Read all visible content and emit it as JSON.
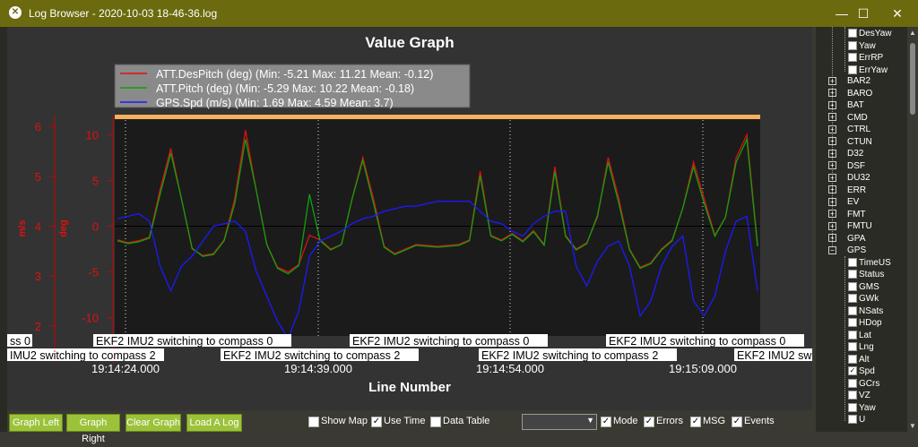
{
  "window": {
    "title": "Log Browser - 2020-10-03 18-46-36.log",
    "minimize": "—",
    "maximize": "☐",
    "close": "✕"
  },
  "graph": {
    "title": "Value Graph",
    "xlabel": "Line Number",
    "yaxis_left_label": "m/s",
    "yaxis_right_label": "deg",
    "ms_ticks": [
      "6",
      "5",
      "4",
      "3",
      "2"
    ],
    "deg_ticks": [
      "10",
      "5",
      "0",
      "-5",
      "-10"
    ],
    "time_labels": [
      "19:14:24.000",
      "19:14:39.000",
      "19:14:54.000",
      "19:15:09.000"
    ],
    "event_labels_row1": [
      "ss 0",
      "EKF2 IMU2 switching to compass 0",
      "EKF2 IMU2 switching to compass 0",
      "EKF2 IMU2 switching to compass 0"
    ],
    "event_labels_row2": [
      "IMU2 switching to compass 2",
      "EKF2 IMU2 switching to compass 2",
      "EKF2 IMU2 switching to compass 2",
      "EKF2 IMU2 sw"
    ],
    "colors": {
      "plot_bg": "#1b1b1b",
      "despitch": "#e01010",
      "pitch": "#10a010",
      "gps": "#1a1aff",
      "band": "#f5b060"
    }
  },
  "chart_data": {
    "type": "line",
    "x": [
      0,
      1,
      2,
      3,
      4,
      5,
      6,
      7,
      8,
      9,
      10,
      11,
      12,
      13,
      14,
      15,
      16,
      17,
      18,
      19,
      20,
      21,
      22,
      23,
      24,
      25,
      26,
      27,
      28,
      29,
      30,
      31,
      32,
      33,
      34,
      35,
      36,
      37,
      38,
      39,
      40,
      41,
      42,
      43,
      44,
      45,
      46,
      47,
      48,
      49,
      50,
      51,
      52,
      53,
      54,
      55,
      56,
      57,
      58,
      59,
      60
    ],
    "series": [
      {
        "name": "ATT.DesPitch (deg) (Min: -5.21 Max: 11.21 Mean: -0.12)",
        "axis": "deg",
        "values": [
          -1.5,
          -1.8,
          -1.6,
          -1.2,
          4,
          8.5,
          3,
          -2.5,
          -3.2,
          -3,
          -1.5,
          3,
          10.5,
          4,
          -2,
          -4.5,
          -5,
          -4.2,
          -1,
          -1.5,
          -2.5,
          -2,
          3,
          7.5,
          3,
          -2.2,
          -3,
          -2.5,
          -2,
          -2.1,
          -2.2,
          -2.1,
          -2,
          -1.5,
          6,
          -1,
          -1.5,
          -0.8,
          -1.6,
          -0.5,
          -2,
          6.5,
          -1,
          -2.5,
          -1.8,
          1,
          7.5,
          3,
          -2.5,
          -4.5,
          -4,
          -2.5,
          -1.5,
          2,
          7,
          3,
          -1,
          1,
          7.5,
          10,
          -2
        ]
      },
      {
        "name": "ATT.Pitch (deg) (Min: -5.29 Max: 10.22 Mean: -0.18)",
        "axis": "deg",
        "values": [
          -1.6,
          -1.9,
          -1.7,
          -1.3,
          3.5,
          8,
          3,
          -2.4,
          -3.3,
          -3.1,
          -1.6,
          2.5,
          9.5,
          4,
          -2,
          -4.6,
          -5.2,
          -4.3,
          3.5,
          -1.6,
          -2.6,
          -2,
          3,
          7.2,
          2.5,
          -2.3,
          -3.1,
          -2.6,
          -2.1,
          -2.2,
          -2.3,
          -2.2,
          -2.1,
          -1.6,
          5.5,
          -1.1,
          -1.6,
          -0.9,
          -1.7,
          -0.6,
          -2.1,
          6,
          -1.1,
          -2.6,
          -1.9,
          1.2,
          7,
          2.5,
          -2.6,
          -4.6,
          -4.1,
          -2.6,
          -1.6,
          2,
          6.5,
          2.5,
          -1.1,
          1,
          7,
          9.5,
          -2.2
        ]
      },
      {
        "name": "GPS.Spd (m/s) (Min: 1.69 Max: 4.59 Mean: 3.7)",
        "axis": "m/s",
        "values": [
          4.15,
          4.2,
          4.25,
          4.1,
          3.2,
          2.7,
          3.2,
          3.4,
          3.7,
          4,
          4.05,
          4.1,
          3.9,
          3.1,
          2.6,
          2.1,
          1.75,
          2.3,
          3.4,
          3.7,
          3.8,
          3.9,
          4.05,
          4.15,
          4.2,
          4.3,
          4.35,
          4.4,
          4.4,
          4.45,
          4.5,
          4.5,
          4.5,
          4.5,
          4.3,
          4.1,
          4.05,
          3.9,
          3.8,
          4.05,
          4.2,
          4.3,
          4.3,
          3.2,
          2.8,
          3.3,
          3.6,
          3.7,
          3.2,
          2.2,
          2.5,
          3.2,
          3.6,
          3.8,
          2.5,
          2.2,
          2.6,
          3.5,
          4.1,
          4.2,
          2.7
        ]
      }
    ],
    "ylim_deg": [
      -12,
      12
    ],
    "ylim_ms": [
      1.8,
      6.2
    ],
    "legend_position": "top-left",
    "grid": false
  },
  "toolbar": {
    "graph_left": "Graph Left",
    "graph_right": "Graph Right",
    "clear_graph": "Clear Graph",
    "load_log": "Load A Log",
    "show_map": "Show Map",
    "use_time": "Use Time",
    "data_table": "Data Table",
    "mode": "Mode",
    "errors": "Errors",
    "msg": "MSG",
    "events": "Events",
    "show_map_checked": false,
    "use_time_checked": true,
    "data_table_checked": false,
    "mode_checked": true,
    "errors_checked": true,
    "msg_checked": true,
    "events_checked": true
  },
  "tree": {
    "top_children": [
      {
        "label": "DesYaw",
        "checked": false
      },
      {
        "label": "Yaw",
        "checked": false
      },
      {
        "label": "ErrRP",
        "checked": false
      },
      {
        "label": "ErrYaw",
        "checked": false
      }
    ],
    "groups": [
      "BAR2",
      "BARO",
      "BAT",
      "CMD",
      "CTRL",
      "CTUN",
      "D32",
      "DSF",
      "DU32",
      "ERR",
      "EV",
      "FMT",
      "FMTU",
      "GPA"
    ],
    "expanded_group": "GPS",
    "gps_children": [
      {
        "label": "TimeUS",
        "checked": false
      },
      {
        "label": "Status",
        "checked": false
      },
      {
        "label": "GMS",
        "checked": false
      },
      {
        "label": "GWk",
        "checked": false
      },
      {
        "label": "NSats",
        "checked": false
      },
      {
        "label": "HDop",
        "checked": false
      },
      {
        "label": "Lat",
        "checked": false
      },
      {
        "label": "Lng",
        "checked": false
      },
      {
        "label": "Alt",
        "checked": false
      },
      {
        "label": "Spd",
        "checked": true
      },
      {
        "label": "GCrs",
        "checked": false
      },
      {
        "label": "VZ",
        "checked": false
      },
      {
        "label": "Yaw",
        "checked": false
      },
      {
        "label": "U",
        "checked": false
      }
    ]
  }
}
